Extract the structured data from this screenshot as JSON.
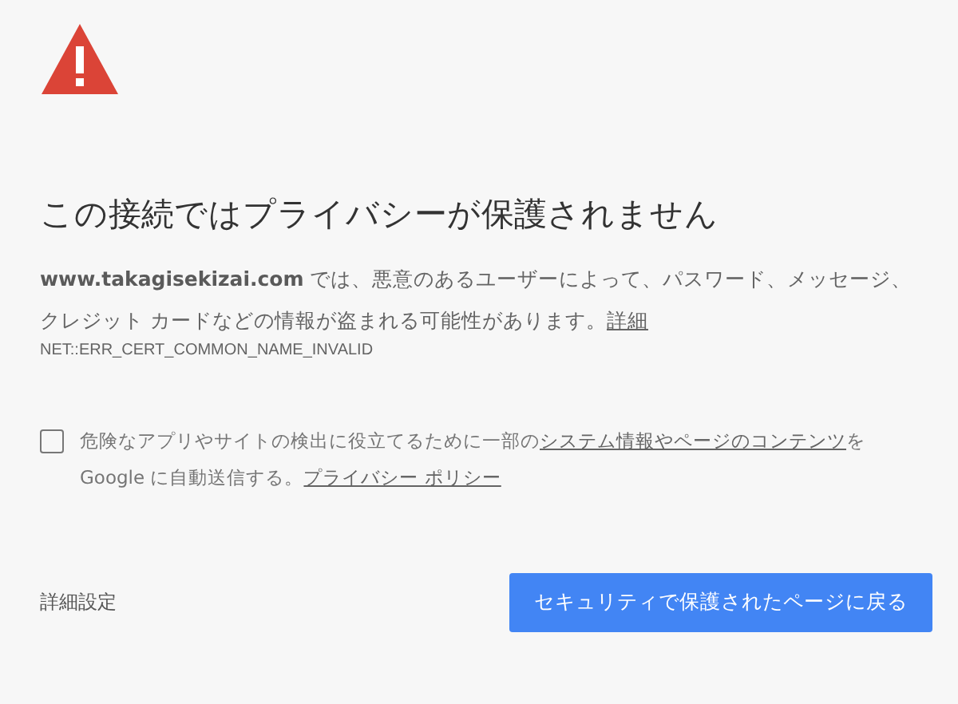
{
  "title": "この接続ではプライバシーが保護されません",
  "description": {
    "segments": [
      {
        "kind": "text",
        "text": "**www.takagisekizai.com** では、悪意のあるユーザーによって、パスワード、メッセージ、クレジット カードなどの情報が盗まれる可能性があります。"
      },
      {
        "kind": "link",
        "text": "詳細"
      }
    ]
  },
  "error_code": "NET::ERR_CERT_COMMON_NAME_INVALID",
  "report": {
    "checked": false,
    "segments": [
      {
        "kind": "text",
        "text": "危険なアプリやサイトの検出に役立てるために一部の"
      },
      {
        "kind": "link",
        "text": "システム情報やページのコンテンツ"
      },
      {
        "kind": "text",
        "text": "を Google に自動送信する。"
      },
      {
        "kind": "link",
        "text": "プライバシー ポリシー"
      }
    ]
  },
  "advanced_link": "詳細設定",
  "back_button": "セキュリティで保護されたページに戻る"
}
